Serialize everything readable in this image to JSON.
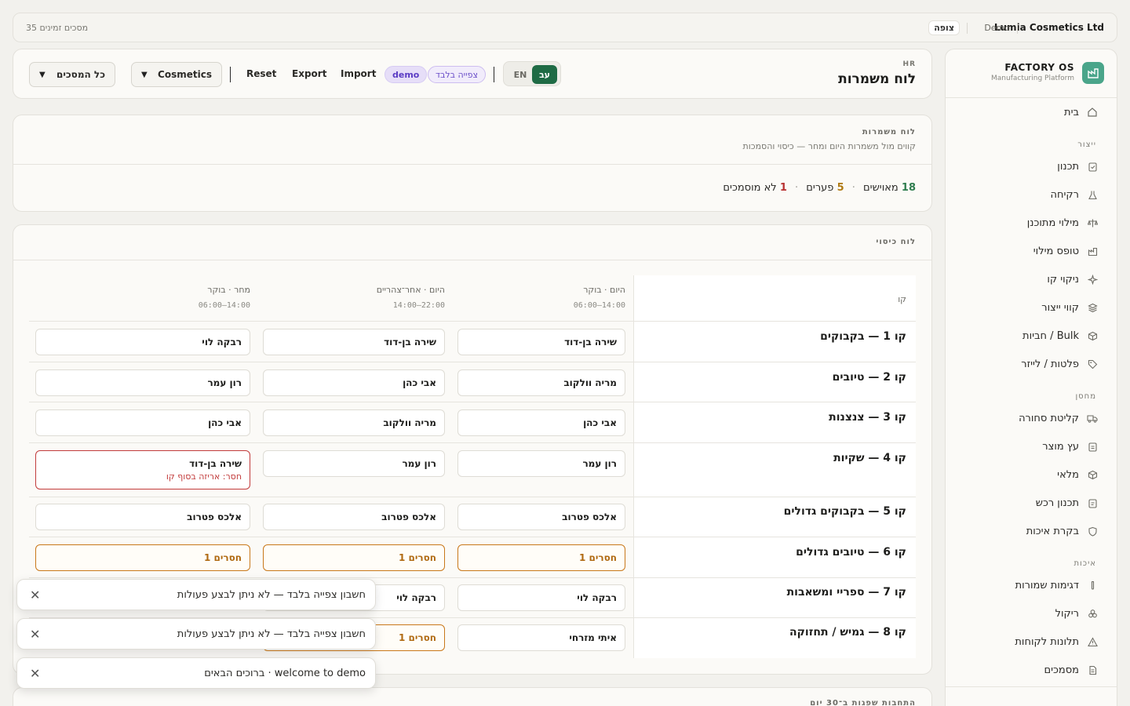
{
  "topbar": {
    "company": "Lumia Cosmetics Ltd",
    "env": "Demo",
    "role": "צופה",
    "screens_available": "35 מסכים זמינים"
  },
  "sidebar": {
    "brand": "FACTORY OS",
    "brand_sub": "Manufacturing Platform",
    "home": {
      "label": "בית",
      "icon": "home-icon"
    },
    "sections": [
      {
        "title": "ייצור",
        "items": [
          {
            "label": "תכנון",
            "icon": "clipboard-icon"
          },
          {
            "label": "רקיחה",
            "icon": "flask-icon"
          },
          {
            "label": "מילוי מתוכנן",
            "icon": "scale-icon"
          },
          {
            "label": "טופס מילוי",
            "icon": "factory-icon"
          },
          {
            "label": "ניקוי קו",
            "icon": "sparkle-icon"
          },
          {
            "label": "קווי ייצור",
            "icon": "layers-icon"
          },
          {
            "label": "חביות / Bulk",
            "icon": "box-icon"
          },
          {
            "label": "פלטות / לייזר",
            "icon": "tag-icon"
          }
        ]
      },
      {
        "title": "מחסן",
        "items": [
          {
            "label": "קליטת סחורה",
            "icon": "truck-icon"
          },
          {
            "label": "עץ מוצר",
            "icon": "clipboard-list-icon"
          },
          {
            "label": "מלאי",
            "icon": "package-icon"
          },
          {
            "label": "תכנון רכש",
            "icon": "clipboard-check-icon"
          },
          {
            "label": "בקרת איכות",
            "icon": "shield-icon"
          }
        ]
      },
      {
        "title": "איכות",
        "items": [
          {
            "label": "דגימות שמורות",
            "icon": "test-tube-icon"
          },
          {
            "label": "ריקול",
            "icon": "biohazard-icon"
          },
          {
            "label": "תלונות לקוחות",
            "icon": "warning-icon"
          },
          {
            "label": "מסמכים",
            "icon": "document-icon"
          }
        ]
      }
    ]
  },
  "header": {
    "eyebrow": "HR",
    "title": "לוח משמרות",
    "lang_he": "עב",
    "lang_en": "EN",
    "pill_view_only": "צפייה בלבד",
    "pill_demo": "demo",
    "import": "Import",
    "export": "Export",
    "reset": "Reset",
    "select_org": "Cosmetics",
    "select_screens": "כל המסכים"
  },
  "summary": {
    "eyebrow": "לוח משמרות",
    "subtitle": "קווים מול משמרות היום ומחר — כיסוי והסמכות",
    "staffed_count": "18",
    "staffed_label": "מאוישים",
    "gaps_count": "5",
    "gaps_label": "פערים",
    "uncert_count": "1",
    "uncert_label": "לא מוסמכים"
  },
  "coverage": {
    "eyebrow": "לוח כיסוי",
    "col_line": "קו",
    "shifts": [
      {
        "title": "היום · בוקר",
        "hours": "06:00–14:00"
      },
      {
        "title": "היום · אחר־צהריים",
        "hours": "14:00–22:00"
      },
      {
        "title": "מחר · בוקר",
        "hours": "06:00–14:00"
      }
    ],
    "rows": [
      {
        "line": "קו 1 — בקבוקים",
        "cells": [
          "שירה בן-דוד",
          "שירה בן-דוד",
          "רבקה לוי"
        ]
      },
      {
        "line": "קו 2 — טיובים",
        "cells": [
          "מריה וולקוב",
          "אבי כהן",
          "רון עמר"
        ]
      },
      {
        "line": "קו 3 — צנצנות",
        "cells": [
          "אבי כהן",
          "מריה וולקוב",
          "אבי כהן"
        ]
      },
      {
        "line": "קו 4 — שקיות",
        "cells": [
          "רון עמר",
          "רון עמר",
          "שירה בן-דוד"
        ],
        "warn_note": "חסר: אריזה בסוף קו"
      },
      {
        "line": "קו 5 — בקבוקים גדולים",
        "cells": [
          "אלכס פטרוב",
          "אלכס פטרוב",
          "אלכס פטרוב"
        ]
      },
      {
        "line": "קו 6 — טיובים גדולים",
        "cells": [
          "חסרים 1",
          "חסרים 1",
          "חסרים 1"
        ]
      },
      {
        "line": "קו 7 — ספריי ומשאבות",
        "cells": [
          "רבקה לוי",
          "רבקה לוי",
          ""
        ]
      },
      {
        "line": "קו 8 — גמיש / תחזוקה",
        "cells": [
          "איתי מזרחי",
          "חסרים 1",
          ""
        ]
      }
    ]
  },
  "next_card": {
    "eyebrow": "התחבות שפגות ב־30 יום"
  },
  "toasts": [
    {
      "message": "חשבון צפייה בלבד — לא ניתן לבצע פעולות"
    },
    {
      "message": "חשבון צפייה בלבד — לא ניתן לבצע פעולות"
    },
    {
      "message": "ברוכים הבאים · welcome to demo"
    }
  ]
}
